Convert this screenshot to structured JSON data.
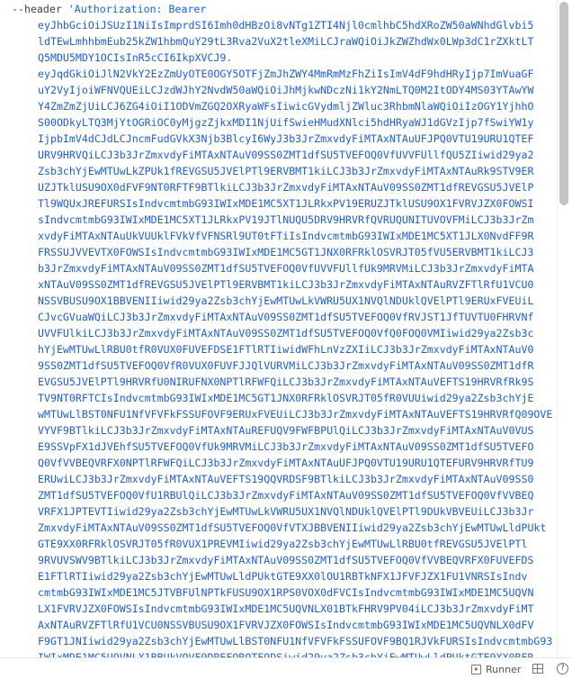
{
  "editor": {
    "first_line": {
      "flag": "--header",
      "string_start": " 'Authorization: Bearer"
    },
    "jwt_lines": [
      "eyJhbGciOiJSUzI1NiIsImprdSI6Imh0dHBzOi8vNTg1ZTI4Njl0cmlhbC5hdXRoZW50aWNhdGlvbi5",
      "ldTEwLmhhbmEub25kZW1hbmQuY29tL3Rva2VuX2tleXMiLCJraWQiOiJkZWZhdWx0LWp3dC1rZXktLT",
      "Q5MDU5MDY1OCIsInR5cCI6IkpXVCJ9.",
      "eyJqdGkiOiJlN2VkY2EzZmUyOTE0OGY5OTFjZmJhZWY4MmRmMzFhZiIsImV4dF9hdHRyIjp7ImVuaGF",
      "uY2VyIjoiWFNVQUEiLCJzdWJhY2NvdW50aWQiOiJhMjkwNDczNi1kY2NmLTQ0M2ItODY4MS03YTAwYW",
      "Y4ZmZmZjUiLCJ6ZG4iOiI1ODVmZGQ2OXRyaWFsIiwicGVydmljZWluc3RhbmNlaWQiOiIzOGY1YjhhO",
      "S00ODkyLTQ3MjYtOGRiOC0yMjgzZjkxMDI1NjUifSwieHMudXNlci5hdHRyaWJ1dGVzIjp7fSwiYW1y",
      "IjpbImV4dCJdLCJncmFudGVkX3Njb3BlcyI6WyJ3b3JrZmxvdyFiMTAxNTAuUFJPQ0VTU19URU1QTEF",
      "URV9HRVQiLCJ3b3JrZmxvdyFiMTAxNTAuV09SS0ZMT1dfSU5TVEFOQ0VfUVVFUllfQU5ZIiwid29ya2",
      "Zsb3chYjEwMTUwLkZPUk1fREVGSU5JVElPTl9ERVBMT1kiLCJ3b3JrZmxvdyFiMTAxNTAuRk9STV9ER",
      "UZJTklUSU9OX0dFVF9NT0RFTF9BTlkiLCJ3b3JrZmxvdyFiMTAxNTAuV09SS0ZMT1dfREVGSU5JVElP",
      "Tl9WQUxJREFURSIsIndvcmtmbG93IWIxMDE1MC5XT1JLRkxPV19ERUZJTklUSU9OX1FVRVJZX0FOWSI",
      "sIndvcmtmbG93IWIxMDE1MC5XT1JLRkxPV19JTlNUQU5DRV9HRVRfQVRUQUNITUVOVFMiLCJ3b3JrZm",
      "xvdyFiMTAxNTAuUkVUUklFVkVfVFNSRl9UT0tFTiIsIndvcmtmbG93IWIxMDE1MC5XT1JLX0NvdFF9R",
      "FRSSUJVVEVTX0FOWSIsIndvcmtmbG93IWIxMDE1MC5GT1JNX0RFRklOSVRJT05fVU5ERVBMT1kiLCJ3",
      "b3JrZmxvdyFiMTAxNTAuV09SS0ZMT1dfSU5TVEFOQ0VfUVVFUllfUk9MRVMiLCJ3b3JrZmxvdyFiMTA",
      "xNTAuV09SS0ZMT1dfREVGSU5JVElPTl9ERVBMT1kiLCJ3b3JrZmxvdyFiMTAxNTAuRVZFTlRfU1VCU0",
      "NSSVBUSU9OX1BBVENIIiwid29ya2Zsb3chYjEwMTUwLkVWRU5UX1NVQlNDUklQVElPTl9ERUxFVEUiL",
      "CJvcGVuaWQiLCJ3b3JrZmxvdyFiMTAxNTAuV09SS0ZMT1dfSU5TVEFOQ0VfRVJST1JfTUVTU0FHRVNf",
      "UVVFUlkiLCJ3b3JrZmxvdyFiMTAxNTAuV09SS0ZMT1dfSU5TVEFOQ0VfQ0FOQ0VMIiwid29ya2Zsb3c",
      "hYjEwMTUwLlRBU0tfR0VUX0FUVEFDSE1FTlRTIiwidWFhLnVzZXIiLCJ3b3JrZmxvdyFiMTAxNTAuV0",
      "9SS0ZMT1dfSU5TVEFOQ0VfR0VUX0FUVFJJQlVURVMiLCJ3b3JrZmxvdyFiMTAxNTAuV09SS0ZMT1dfR",
      "EVGSU5JVElPTl9HRVRfU0NIRUFNX0NPTlRFWFQiLCJ3b3JrZmxvdyFiMTAxNTAuVEFTS19HRVRfRk9S",
      "TV9NT0RFTCIsIndvcmtmbG93IWIxMDE1MC5GT1JNX0RFRklOSVRJT05fR0VUUiwid29ya2Zsb3chYjE",
      "wMTUwLlBST0NFU1NfVFVFkFSSUFOVF9ERUxFVEUiLCJ3b3JrZmxvdyFiMTAxNTAuVEFTS19HRVRfQ09OVE",
      "VYVF9BTlkiLCJ3b3JrZmxvdyFiMTAxNTAuREFUQV9FWFBPUlQiLCJ3b3JrZmxvdyFiMTAxNTAuV0VUS",
      "E9SSVpFX1dJVEhfSU5TVEFOQ0VfUk9MRVMiLCJ3b3JrZmxvdyFiMTAxNTAuV09SS0ZMT1dfSU5TVEFO",
      "Q0VfVVBEQVRFX0NPTlRFWFQiLCJ3b3JrZmxvdyFiMTAxNTAuUFJPQ0VTU19URU1QTEFURV9HRVRfTU9",
      "ERUwiLCJ3b3JrZmxvdyFiMTAxNTAuVEFTS19QQVRDSF9BTlkiLCJ3b3JrZmxvdyFiMTAxNTAuV09SS0",
      "ZMT1dfSU5TVEFOQ0VfU1RBUlQiLCJ3b3JrZmxvdyFiMTAxNTAuV09SS0ZMT1dfSU5TVEFOQ0VfVVBEQ",
      "VRFX1JPTEVTIiwid29ya2Zsb3chYjEwMTUwLkVWRU5UX1NVQlNDUklQVElPTl9DUkVBVEUiLCJ3b3Jr",
      "ZmxvdyFiMTAxNTAuV09SS0ZMT1dfSU5TVEFOQ0VfVTXJBBVENIIiwid29ya2Zsb3chYjEwMTUwLldPUkt",
      "GTE9XX0RFRklOSVRJT05fR0VUX1PREVMIiwid29ya2Zsb3chYjEwMTUwLlRBU0tfREVGSU5JVElPTl",
      "9RVUVSWV9BTlkiLCJ3b3JrZmxvdyFiMTAxNTAuV09SS0ZMT1dfSU5TVEFOQ0VfVVBEQVRFX0FUVEFDS",
      "E1FTlRTIiwid29ya2Zsb3chYjEwMTUwLldPUktGTE9XX0lOU1RBTkNFX1JFVFJZX1FU1VNRSIsIndv",
      "cmtmbG93IWIxMDE1MC5JTVBFUlNPTkFUSU9OX1RPS0VOX0dFVCIsIndvcmtmbG93IWIxMDE1MC5UQVN",
      "LX1FVRVJZX0FOWSIsIndvcmtmbG93IWIxMDE1MC5UQVNLX01BTkFHRV9PV04iLCJ3b3JrZmxvdyFiMT",
      "AxNTAuRVZFTlRfU1VCU0NSSVBUSU9OX1FVRVJZX0FOWSIsIndvcmtmbG93IWIxMDE1MC5UQVNLX0dFV",
      "F9GT1JNIiwid29ya2Zsb3chYjEwMTUwLlBST0NFU1NfVFVFkFSSUFOVF9BQ1RJVkFURSIsIndvcmtmbG93",
      "IWIxMDE1MC5UQVNLX1BBUkVOVF9DREFOROTF9DSiwid29ya2Zsb3chYjEwMTUwLldPUktGTE9XX0RFR"
    ]
  },
  "status_bar": {
    "runner_label": "Runner",
    "runner_icon": "runner-panel-icon",
    "layout_icon": "layout-grid-icon",
    "help_icon": "help-icon",
    "help_glyph": "?"
  },
  "colors": {
    "token_string": "#1a5fd6",
    "token_flag": "#444444",
    "scrollbar_thumb": "#c4c4c4"
  }
}
